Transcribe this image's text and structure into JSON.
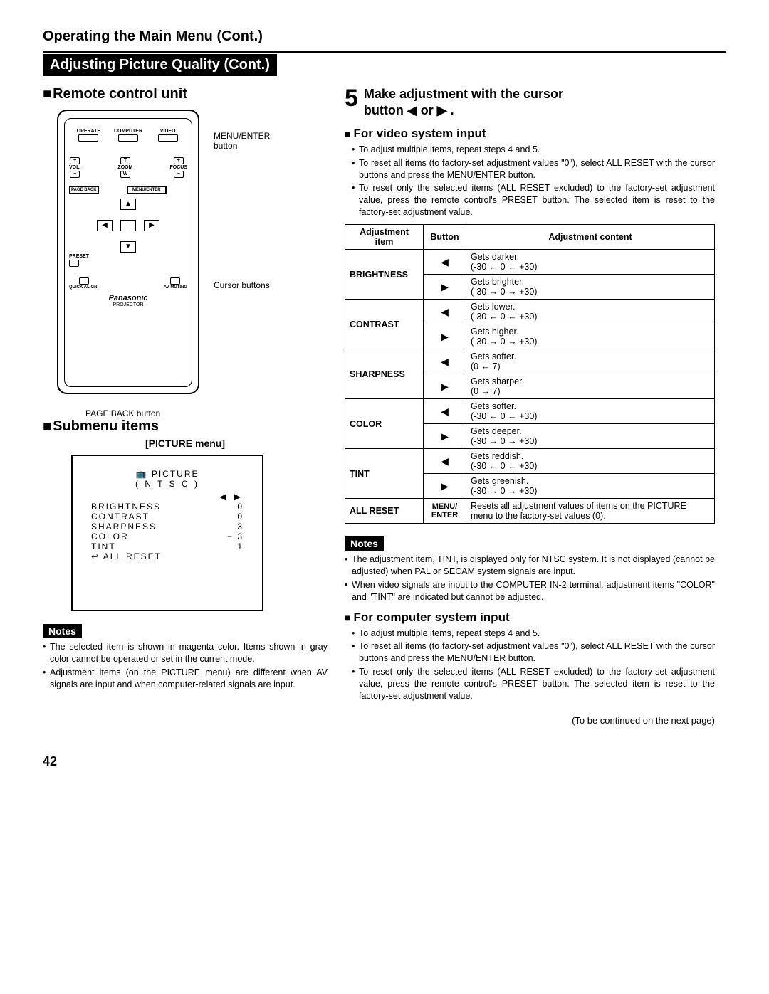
{
  "header": {
    "operating": "Operating the Main Menu (Cont.)",
    "banner": "Adjusting Picture Quality (Cont.)"
  },
  "left": {
    "remote_heading": "Remote control unit",
    "labels": {
      "menu_enter": "MENU/ENTER button",
      "cursor_buttons": "Cursor buttons",
      "page_back": "PAGE BACK button",
      "operate": "OPERATE",
      "computer": "COMPUTER",
      "video": "VIDEO",
      "vol": "VOL.",
      "zoom": "ZOOM",
      "focus": "FOCUS",
      "page_back_btn": "PAGE BACK",
      "menu_enter_btn": "MENU/ENTER",
      "preset": "PRESET",
      "quick_align": "QUICK ALIGN.",
      "av_muting": "AV MUTING",
      "brand": "Panasonic",
      "projector": "PROJECTOR",
      "t": "T",
      "w": "W",
      "plus": "+",
      "minus": "−"
    },
    "submenu_heading": "Submenu items",
    "picture_menu_caption": "[PICTURE menu]",
    "picture_menu": {
      "icon": "📺",
      "title": "PICTURE",
      "system": "( N T S C )",
      "arrows": "◀ ▶",
      "rows": [
        {
          "label": "BRIGHTNESS",
          "val": "0"
        },
        {
          "label": "CONTRAST",
          "val": "0"
        },
        {
          "label": "SHARPNESS",
          "val": "3"
        },
        {
          "label": "COLOR",
          "val": "−    3"
        },
        {
          "label": "TINT",
          "val": "1"
        }
      ],
      "all_reset_icon": "↩",
      "all_reset": "ALL RESET"
    },
    "notes_label": "Notes",
    "notes": [
      "The selected item is shown in magenta color. Items shown in gray color cannot be operated or set in the current mode.",
      "Adjustment items (on the PICTURE menu) are different when AV signals are input and when computer-related signals are input."
    ]
  },
  "right": {
    "step5_num": "5",
    "step5_text_a": "Make adjustment with the cursor",
    "step5_text_b": "button ◀ or ▶ .",
    "video_heading": "For video system input",
    "video_bullets": [
      "To adjust multiple items, repeat steps 4 and 5.",
      "To reset all items (to factory-set adjustment values \"0\"), select ALL RESET with the cursor buttons and press the MENU/ENTER button.",
      "To reset only the selected items (ALL RESET excluded) to the factory-set adjustment value, press the remote control's PRESET button. The selected item is reset to the factory-set adjustment value."
    ],
    "table": {
      "h1": "Adjustment item",
      "h2": "Button",
      "h3": "Adjustment content",
      "rows": [
        {
          "item": "BRIGHTNESS",
          "l1": "Gets darker.",
          "l2": "(-30 ← 0 ← +30)",
          "r1": "Gets brighter.",
          "r2": "(-30 → 0 → +30)"
        },
        {
          "item": "CONTRAST",
          "l1": "Gets lower.",
          "l2": "(-30 ← 0 ← +30)",
          "r1": "Gets higher.",
          "r2": "(-30 → 0 → +30)"
        },
        {
          "item": "SHARPNESS",
          "l1": "Gets softer.",
          "l2": "(0 ← 7)",
          "r1": "Gets sharper.",
          "r2": "(0 → 7)"
        },
        {
          "item": "COLOR",
          "l1": "Gets softer.",
          "l2": "(-30 ← 0 ← +30)",
          "r1": "Gets deeper.",
          "r2": "(-30 → 0 → +30)"
        },
        {
          "item": "TINT",
          "l1": "Gets reddish.",
          "l2": "(-30 ← 0 ← +30)",
          "r1": "Gets greenish.",
          "r2": "(-30 → 0 → +30)"
        }
      ],
      "reset_item": "ALL RESET",
      "reset_btn": "MENU/\nENTER",
      "reset_content": "Resets all adjustment values of items on the PICTURE menu to the factory-set values (0)."
    },
    "notes_label": "Notes",
    "video_notes": [
      "The adjustment item, TINT, is displayed only for NTSC system. It is not displayed (cannot be adjusted) when PAL or SECAM system signals are input.",
      "When video signals are input to the COMPUTER IN-2 terminal, adjustment items \"COLOR\" and \"TINT\" are indicated but cannot be adjusted."
    ],
    "computer_heading": "For computer system input",
    "computer_bullets": [
      "To adjust multiple items, repeat steps 4 and 5.",
      "To reset all items (to factory-set adjustment values \"0\"), select ALL RESET with the cursor buttons and press the MENU/ENTER button.",
      "To reset only the selected items (ALL RESET excluded) to the factory-set adjustment value, press the remote control's PRESET button. The selected item is reset to the factory-set adjustment value."
    ],
    "continued": "(To be continued on the next page)"
  },
  "page_number": "42"
}
